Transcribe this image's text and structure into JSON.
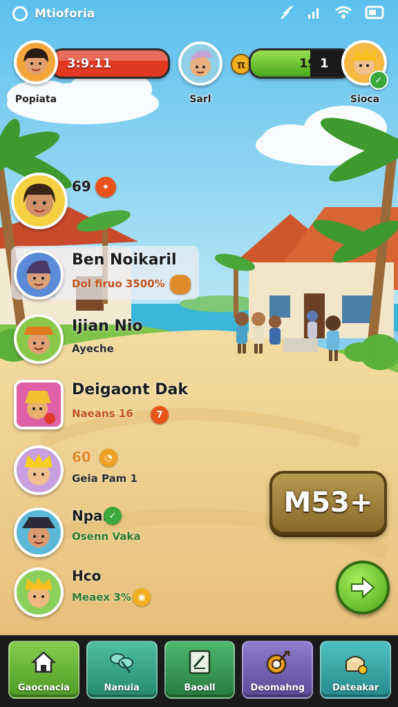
{
  "status_bar": {
    "title": "Mtioforia"
  },
  "hud": {
    "left_player": {
      "name": "Popiata",
      "score": "3:9.11"
    },
    "center_player": {
      "name": "Sarl"
    },
    "right_player": {
      "name": "Sioca",
      "score": "19",
      "level": "1"
    },
    "coin_symbol": "π"
  },
  "roster": [
    {
      "name": "",
      "sub": "69",
      "badge": "",
      "badge_color": "#e8531b"
    },
    {
      "name": "Ben Noikaril",
      "sub": "Dol firuo 3500%",
      "badge": "",
      "badge_color": "#e08a2a",
      "highlighted": true
    },
    {
      "name": "Ijian Nio",
      "sub": "Ayeche",
      "badge": "",
      "badge_color": ""
    },
    {
      "name": "Deigaont Dak",
      "sub": "Naeans 16",
      "badge": "7",
      "badge_color": "#e8531b"
    },
    {
      "name": "",
      "sub": "Geia Pam 1",
      "top": "60",
      "badge": "",
      "badge_color": "#f0a020"
    },
    {
      "name": "Npar",
      "sub": "Osenn Vaka",
      "badge": "",
      "badge_color": "#3aa83a"
    },
    {
      "name": "Hco",
      "sub": "Meaex 3%",
      "badge": "",
      "badge_color": "#f0b020"
    }
  ],
  "actions": {
    "big_button": "M53+"
  },
  "nav": [
    {
      "label": "Gaocnacia",
      "icon": "home-icon",
      "color": "#6cb83a"
    },
    {
      "label": "Nanuia",
      "icon": "leaf-icon",
      "color": "#3aa58a"
    },
    {
      "label": "Baoall",
      "icon": "card-icon",
      "color": "#36a05a"
    },
    {
      "label": "Deomahng",
      "icon": "target-icon",
      "color": "#7a68b8"
    },
    {
      "label": "Dateakar",
      "icon": "chest-icon",
      "color": "#3aa5a0"
    }
  ]
}
